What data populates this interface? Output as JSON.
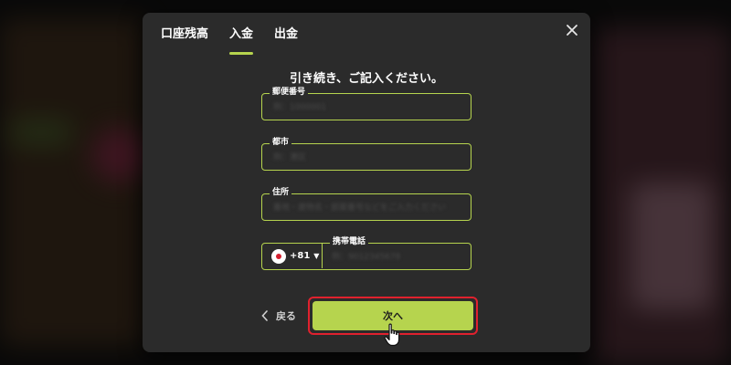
{
  "tabs": [
    {
      "label": "口座残高",
      "active": false
    },
    {
      "label": "入金",
      "active": true
    },
    {
      "label": "出金",
      "active": false
    }
  ],
  "heading": "引き続き、ご記入ください。",
  "fields": {
    "postal": {
      "label": "郵便番号",
      "placeholder": "例：1000001"
    },
    "city": {
      "label": "都市",
      "placeholder": "例：港区"
    },
    "address": {
      "label": "住所",
      "placeholder": "番地・建物名・部屋番号などをご入力ください"
    },
    "phone": {
      "label": "携帯電話",
      "country_code": "+81",
      "placeholder": "例：9012345678"
    }
  },
  "actions": {
    "back_label": "戻る",
    "next_label": "次へ"
  },
  "icons": {
    "close": "close-icon",
    "back": "chevron-left-icon",
    "caret": "caret-down-icon",
    "flag": "japan-flag-icon",
    "cursor": "hand-pointer-icon"
  },
  "colors": {
    "accent": "#b6d44e",
    "highlight": "#e0212e",
    "modal_bg": "#2b2b2b"
  }
}
